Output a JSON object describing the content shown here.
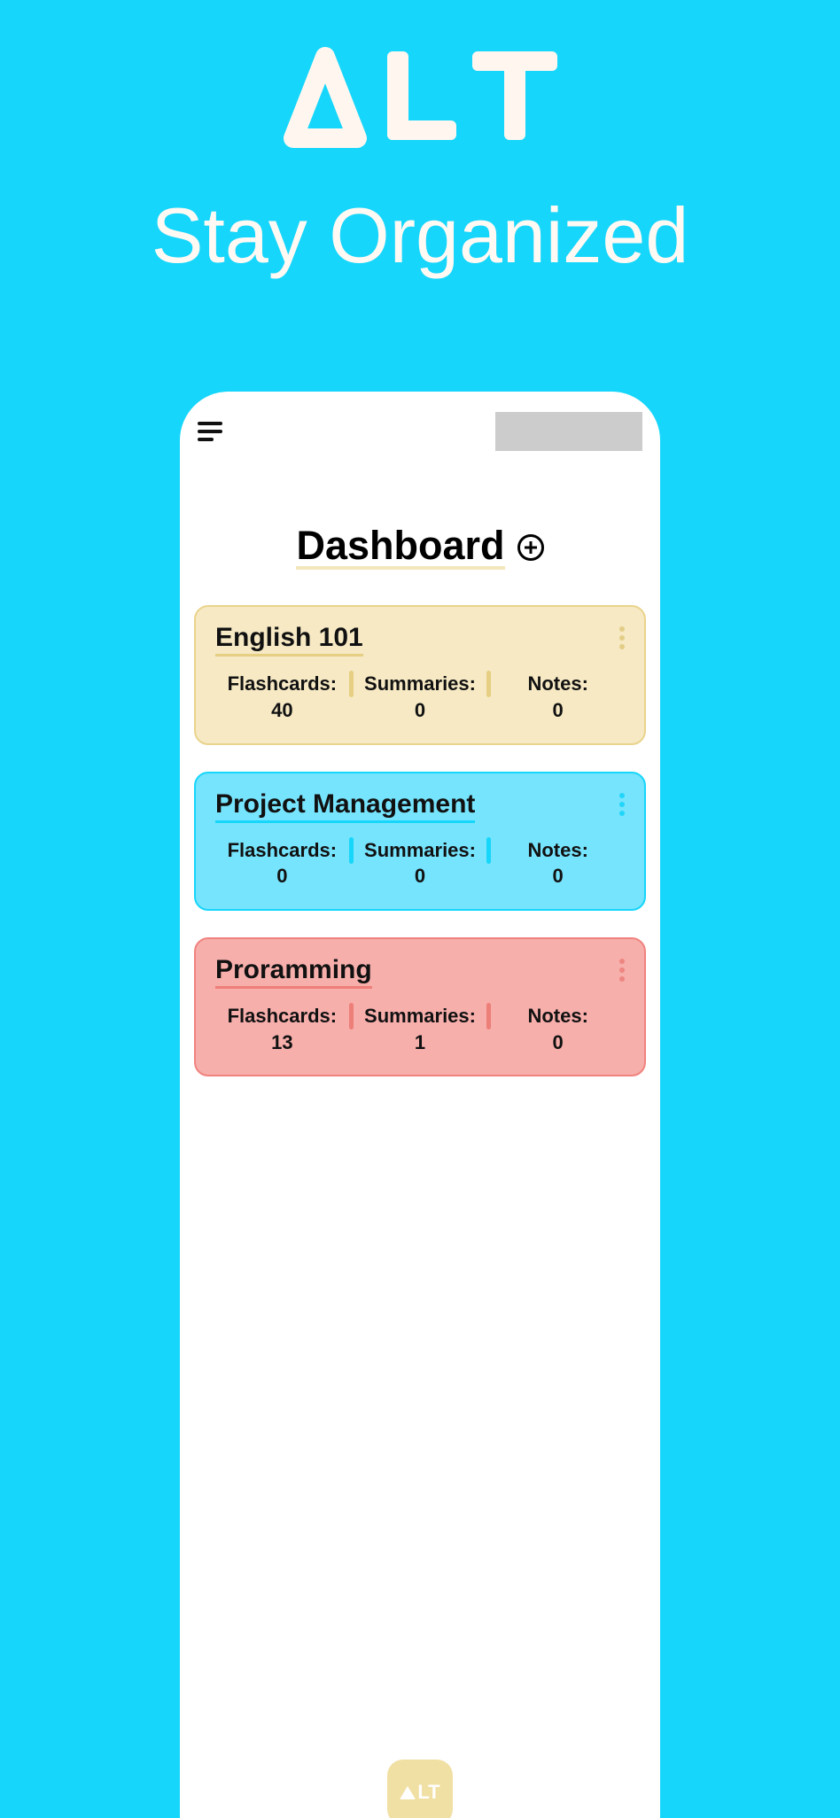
{
  "branding": {
    "name": "ALT",
    "tagline": "Stay Organized"
  },
  "header": {
    "title": "Dashboard"
  },
  "labels": {
    "flashcards": "Flashcards:",
    "summaries": "Summaries:",
    "notes": "Notes:"
  },
  "cards": [
    {
      "title": "English 101",
      "flashcards": "40",
      "summaries": "0",
      "notes": "0",
      "color": "yellow"
    },
    {
      "title": "Project Management",
      "flashcards": "0",
      "summaries": "0",
      "notes": "0",
      "color": "blue"
    },
    {
      "title": "Proramming",
      "flashcards": "13",
      "summaries": "1",
      "notes": "0",
      "color": "red"
    }
  ]
}
